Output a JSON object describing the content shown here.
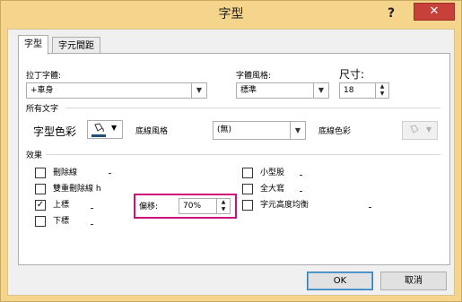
{
  "window": {
    "title": "字型",
    "help_label": "?",
    "close_label": "✕"
  },
  "tabs": [
    {
      "label": "字型",
      "active": true
    },
    {
      "label": "字元間距",
      "active": false
    }
  ],
  "font": {
    "latin_label": "拉丁字體:",
    "latin_value": "+車身",
    "style_label": "字體風格:",
    "style_value": "標準",
    "size_label": "尺寸:",
    "size_value": "18"
  },
  "all_text": {
    "section_label": "所有文字",
    "color_label": "字型色彩",
    "underline_style_label": "底線風格",
    "underline_style_value": "(無)",
    "underline_color_label": "底線色彩"
  },
  "effects": {
    "section_label": "效果",
    "left": [
      {
        "label": "刪除線",
        "checked": false
      },
      {
        "label": "雙重刪除線 h",
        "checked": false
      },
      {
        "label": "上標",
        "checked": true
      },
      {
        "label": "下標",
        "checked": false
      }
    ],
    "right": [
      {
        "label": "小型股",
        "checked": false
      },
      {
        "label": "全大寫",
        "checked": false
      },
      {
        "label": "字元高度均衡",
        "checked": false
      }
    ],
    "offset_label": "偏移:",
    "offset_value": "70%"
  },
  "buttons": {
    "ok": "OK",
    "cancel": "取消"
  },
  "colors": {
    "title_bar": "#f5d58c",
    "close_button": "#c7403a",
    "highlight": "#cc0f7a"
  }
}
